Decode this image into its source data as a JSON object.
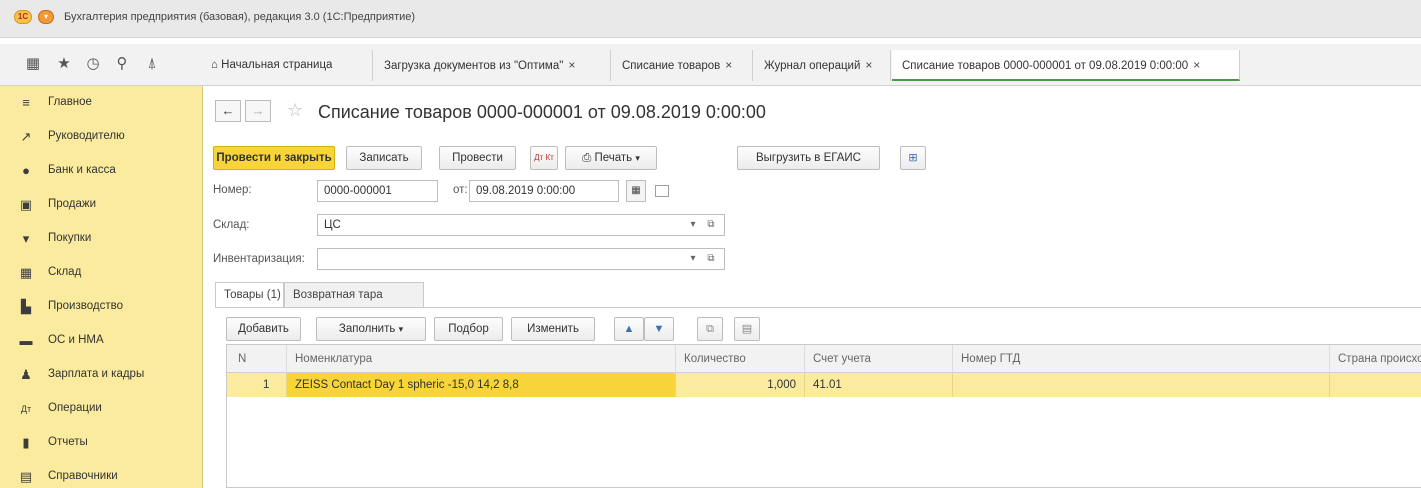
{
  "window": {
    "title": "Бухгалтерия предприятия (базовая), редакция 3.0 (1С:Предприятие)",
    "logo_text": "1С"
  },
  "toolbar": {
    "icons": [
      "apps-grid-icon",
      "star-icon",
      "history-icon",
      "search-icon",
      "bell-icon"
    ]
  },
  "tabs": [
    {
      "label": "Начальная страница",
      "closable": false,
      "icon": "home-icon"
    },
    {
      "label": "Загрузка документов из \"Оптима\"",
      "closable": true
    },
    {
      "label": "Списание товаров",
      "closable": true
    },
    {
      "label": "Журнал операций",
      "closable": true
    },
    {
      "label": "Списание товаров 0000-000001 от 09.08.2019 0:00:00",
      "closable": true,
      "active": true
    }
  ],
  "tab_close_glyph": "×",
  "sidebar": {
    "items": [
      {
        "label": "Главное",
        "icon": "menu-lines-icon"
      },
      {
        "label": "Руководителю",
        "icon": "trend-chart-icon"
      },
      {
        "label": "Банк и касса",
        "icon": "coin-icon"
      },
      {
        "label": "Продажи",
        "icon": "shopping-bag-icon"
      },
      {
        "label": "Покупки",
        "icon": "cart-icon"
      },
      {
        "label": "Склад",
        "icon": "warehouse-icon"
      },
      {
        "label": "Производство",
        "icon": "factory-icon"
      },
      {
        "label": "ОС и НМА",
        "icon": "truck-icon"
      },
      {
        "label": "Зарплата и кадры",
        "icon": "person-icon"
      },
      {
        "label": "Операции",
        "icon": "dt-kt-icon"
      },
      {
        "label": "Отчеты",
        "icon": "bar-chart-icon"
      },
      {
        "label": "Справочники",
        "icon": "book-icon"
      }
    ]
  },
  "document": {
    "title": "Списание товаров 0000-000001 от 09.08.2019 0:00:00",
    "nav_back": "←",
    "nav_forward": "→"
  },
  "command_bar": {
    "post_and_close": "Провести и закрыть",
    "save": "Записать",
    "post": "Провести",
    "dt_kt": "Дт Кт",
    "print": "Печать",
    "export_egais": "Выгрузить в ЕГАИС"
  },
  "form": {
    "number_label": "Номер:",
    "number_value": "0000-000001",
    "date_label": "от:",
    "date_value": "09.08.2019  0:00:00",
    "warehouse_label": "Склад:",
    "warehouse_value": "ЦС",
    "inventory_label": "Инвентаризация:",
    "inventory_value": ""
  },
  "inner_tabs": [
    {
      "label": "Товары (1)",
      "active": true
    },
    {
      "label": "Возвратная тара",
      "active": false
    }
  ],
  "table_bar": {
    "add": "Добавить",
    "fill": "Заполнить",
    "pick": "Подбор",
    "change": "Изменить"
  },
  "table": {
    "columns": [
      "N",
      "Номенклатура",
      "Количество",
      "Счет учета",
      "Номер ГТД",
      "Страна происхождения"
    ],
    "rows": [
      {
        "n": "1",
        "item": "ZEISS Contact Day 1 spheric -15,0 14,2 8,8",
        "qty": "1,000",
        "account": "41.01",
        "gtd": "",
        "country": ""
      }
    ]
  },
  "colors": {
    "sidebar_bg": "#fbeb9e",
    "primary_button": "#f7d43a",
    "selected_row": "#fbeb9e",
    "active_tab_underline": "#4a9a4a"
  }
}
